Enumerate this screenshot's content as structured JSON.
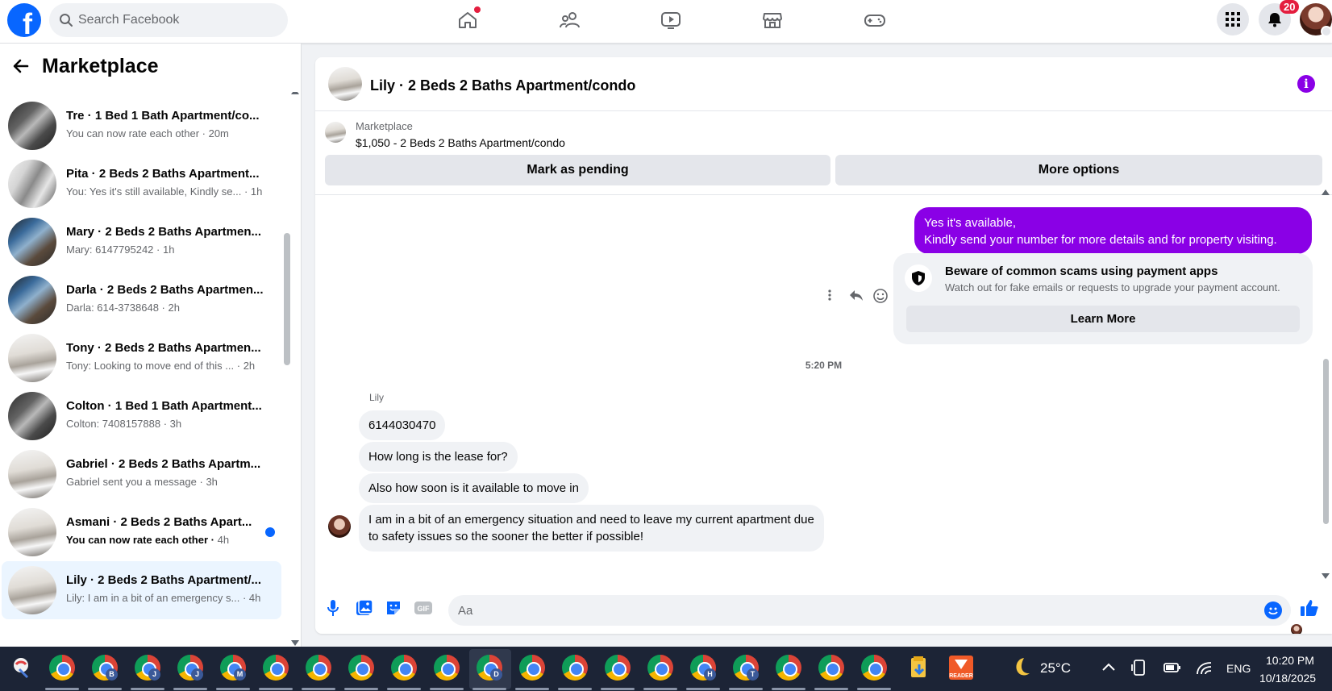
{
  "topbar": {
    "search_placeholder": "Search Facebook",
    "notification_count": "20"
  },
  "sidebar": {
    "title": "Marketplace",
    "threads": [
      {
        "name": "Tre · 1 Bed 1 Bath Apartment/co...",
        "preview": "You can now rate each other",
        "time": "20m",
        "unread": false,
        "active": false
      },
      {
        "name": "Pita · 2 Beds 2 Baths Apartment...",
        "preview": "You: Yes it's still available, Kindly se...",
        "time": "1h",
        "unread": false,
        "active": false
      },
      {
        "name": "Mary · 2 Beds 2 Baths Apartmen...",
        "preview": "Mary: 6147795242",
        "time": "1h",
        "unread": false,
        "active": false
      },
      {
        "name": "Darla · 2 Beds 2 Baths Apartmen...",
        "preview": "Darla: 614-3738648",
        "time": "2h",
        "unread": false,
        "active": false
      },
      {
        "name": "Tony · 2 Beds 2 Baths Apartmen...",
        "preview": "Tony: Looking to move end of this ...",
        "time": "2h",
        "unread": false,
        "active": false
      },
      {
        "name": "Colton · 1 Bed 1 Bath Apartment...",
        "preview": "Colton: 7408157888",
        "time": "3h",
        "unread": false,
        "active": false
      },
      {
        "name": "Gabriel · 2 Beds 2 Baths Apartm...",
        "preview": "Gabriel sent you a message",
        "time": "3h",
        "unread": false,
        "active": false
      },
      {
        "name": "Asmani · 2 Beds 2 Baths Apart...",
        "preview": "You can now rate each other",
        "time": "4h",
        "unread": true,
        "active": false
      },
      {
        "name": "Lily · 2 Beds 2 Baths Apartment/...",
        "preview": "Lily: I am in a bit of an emergency s...",
        "time": "4h",
        "unread": false,
        "active": true
      }
    ]
  },
  "chat": {
    "title": "Lily · 2 Beds 2 Baths Apartment/condo",
    "listing_label": "Marketplace",
    "listing_price": "$1,050 - 2 Beds 2 Baths Apartment/condo",
    "mark_pending_label": "Mark as pending",
    "more_options_label": "More options",
    "outgoing_line1": "Yes it's available,",
    "outgoing_line2": "Kindly send your number for more details and for property visiting.",
    "scam_title": "Beware of common scams using payment apps",
    "scam_body": "Watch out for fake emails or requests to upgrade your payment account.",
    "learn_more_label": "Learn More",
    "timestamp": "5:20 PM",
    "sender_name": "Lily",
    "incoming": [
      "6144030470",
      "How long is the lease for?",
      "Also how soon is it available to move in"
    ],
    "incoming_long_line1": "I am in a bit of an emergency situation and need to leave my current apartment due",
    "incoming_long_line2": "to safety issues so the sooner the better if possible!",
    "composer_placeholder": "Aa"
  },
  "taskbar": {
    "chrome_badges": [
      "",
      "B",
      "J",
      "J",
      "M",
      "",
      "",
      "",
      "",
      "",
      "D",
      "",
      "",
      "",
      "",
      "H",
      "T",
      "",
      "",
      ""
    ],
    "reader_label": "READER",
    "weather": "25°C",
    "language": "ENG",
    "time": "10:20 PM",
    "date": "10/18/2025"
  },
  "colors": {
    "brand_blue": "#0866ff",
    "accent_purple": "#8a00e6",
    "bubble_grey": "#f0f2f5"
  }
}
